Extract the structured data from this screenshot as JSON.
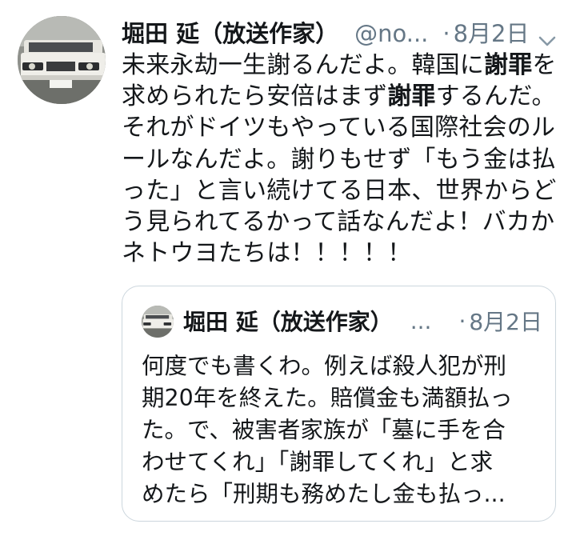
{
  "tweet": {
    "author_name": "堀田 延（放送作家）",
    "handle": "@no...",
    "dot": "·",
    "date": "8月2日",
    "lines": [
      {
        "pre": "未来永劫一生謝るんだよ。韓国に",
        "hl": "謝罪",
        "post": "を"
      },
      {
        "pre": "求められたら安倍はまず",
        "hl": "謝罪",
        "post": "するんだ。"
      },
      {
        "pre": "それがドイツもやっている国際社会のル",
        "hl": "",
        "post": ""
      },
      {
        "pre": "ールなんだよ。謝りもせず「もう金は払",
        "hl": "",
        "post": ""
      },
      {
        "pre": "った」と言い続けてる日本、世界からど",
        "hl": "",
        "post": ""
      },
      {
        "pre": "う見られてるかって話なんだよ！バカか",
        "hl": "",
        "post": ""
      },
      {
        "pre": "ネトウヨたちは！！！！！",
        "hl": "",
        "post": ""
      }
    ]
  },
  "quoted_tweet": {
    "author_name": "堀田 延（放送作家）",
    "ellipsis": "...",
    "dot": "·",
    "date": "8月2日",
    "lines": [
      "何度でも書くわ。例えば殺人犯が刑",
      "期20年を終えた。賠償金も満額払っ",
      "た。で、被害者家族が「墓に手を合",
      "わせてくれ」「謝罪してくれ」と求",
      "めたら「刑期も務めたし金も払っ..."
    ]
  },
  "icons": {
    "caret": "chevron-down-icon",
    "avatar": "car-photo-avatar"
  },
  "colors": {
    "text": "#14171a",
    "secondary": "#657786",
    "border": "#ccd6dd"
  }
}
